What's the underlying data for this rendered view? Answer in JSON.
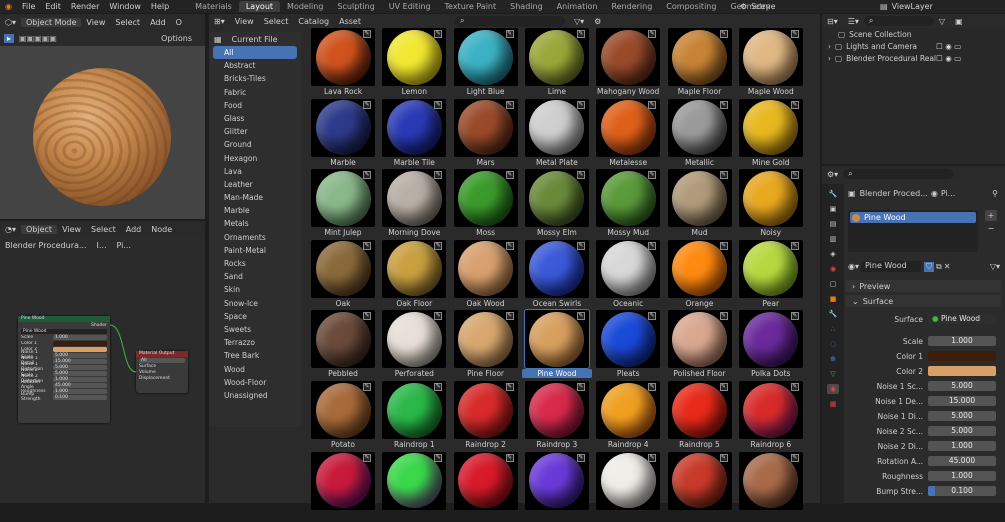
{
  "menu": [
    "File",
    "Edit",
    "Render",
    "Window",
    "Help"
  ],
  "workspaces": [
    "Materials",
    "Layout",
    "Modeling",
    "Sculpting",
    "UV Editing",
    "Texture Paint",
    "Shading",
    "Animation",
    "Rendering",
    "Compositing",
    "Geometry"
  ],
  "active_workspace": "Layout",
  "scene": "Scene",
  "view_layer": "ViewLayer",
  "viewport": {
    "mode": "Object Mode",
    "view": "View",
    "select": "Select",
    "add": "Add",
    "object": "O",
    "options": "Options"
  },
  "node_editor": {
    "mode": "Object",
    "view": "View",
    "select": "Select",
    "add": "Add",
    "node": "Node",
    "breadcrumb": "Blender Procedura...",
    "b2": "I...",
    "b3": "Pi..."
  },
  "node": {
    "group_title": "Pine Wood",
    "shader": "Shader",
    "name": "Pine Wood",
    "rows": [
      [
        "Scale",
        "1.000"
      ],
      [
        "Color 1",
        ""
      ],
      [
        "Color 2",
        ""
      ],
      [
        "Noise 1 Scale",
        "5.000"
      ],
      [
        "Noise 1 Detail",
        "15.000"
      ],
      [
        "Noise 1 Distortion",
        "5.000"
      ],
      [
        "Noise 2 Scale",
        "5.000"
      ],
      [
        "Noise 2 Distortion",
        "1.000"
      ],
      [
        "Rotation Angle",
        "45.000"
      ],
      [
        "Roughness",
        "1.000"
      ],
      [
        "Bump Strength",
        "0.100"
      ]
    ],
    "out_title": "Material Output",
    "out_all": "All",
    "out_rows": [
      "Surface",
      "Volume",
      "Displacement"
    ]
  },
  "asset_browser": {
    "library": "Current File",
    "menus": [
      "View",
      "Select",
      "Catalog",
      "Asset"
    ],
    "catalogs": [
      "All",
      "Abstract",
      "Bricks-Tiles",
      "Fabric",
      "Food",
      "Glass",
      "Glitter",
      "Ground",
      "Hexagon",
      "Lava",
      "Leather",
      "Man-Made",
      "Marble",
      "Metals",
      "Ornaments",
      "Paint-Metal",
      "Rocks",
      "Sand",
      "Skin",
      "Snow-Ice",
      "Space",
      "Sweets",
      "Terrazzo",
      "Tree Bark",
      "Wood",
      "Wood-Floor",
      "Unassigned"
    ],
    "active_catalog": "All",
    "assets": [
      [
        "Lava Rock",
        "#d0521c",
        "#2a0a04"
      ],
      [
        "Lemon",
        "#f2e832",
        "#b3a20a"
      ],
      [
        "Light Blue",
        "#3bb2c4",
        "#0f5a6a"
      ],
      [
        "Lime",
        "#9aa83a",
        "#4f5a1a"
      ],
      [
        "Mahogany Wood",
        "#9a4a2a",
        "#4a1e10"
      ],
      [
        "Maple Floor",
        "#c88436",
        "#6e4016"
      ],
      [
        "Maple Wood",
        "#e0b884",
        "#9a7042"
      ],
      [
        "Marble",
        "#2d3a8a",
        "#0c1030"
      ],
      [
        "Marble Tile",
        "#2a3ab6",
        "#0a1258"
      ],
      [
        "Mars",
        "#9a4a2a",
        "#3e1a0c"
      ],
      [
        "Metal Plate",
        "#cfcfcf",
        "#6a6a6a"
      ],
      [
        "Metalesse",
        "#e0601a",
        "#7a2a06"
      ],
      [
        "Metallic",
        "#9a9a9a",
        "#303030"
      ],
      [
        "Mine Gold",
        "#e8b820",
        "#8a6206"
      ],
      [
        "Mint Julep",
        "#8ab88a",
        "#3e6a44"
      ],
      [
        "Morning Dove",
        "#b8b0a6",
        "#5e5650"
      ],
      [
        "Moss",
        "#3a9a2a",
        "#0e4a0c"
      ],
      [
        "Mossy Elm",
        "#6a8a3a",
        "#2a3a14"
      ],
      [
        "Mossy Mud",
        "#5a9a3a",
        "#1a4a12"
      ],
      [
        "Mud",
        "#b09a7a",
        "#5a4a36"
      ],
      [
        "Noisy",
        "#e8a820",
        "#8a5a06"
      ],
      [
        "Oak",
        "#8a6a3a",
        "#3e2a12"
      ],
      [
        "Oak Floor",
        "#c8a040",
        "#6a5018"
      ],
      [
        "Oak Wood",
        "#d8a070",
        "#8a5a30"
      ],
      [
        "Ocean Swirls",
        "#3a5ad8",
        "#0a1a8a"
      ],
      [
        "Oceanic",
        "#d8d8d8",
        "#7a7a7a"
      ],
      [
        "Orange",
        "#ff8a10",
        "#b04a00"
      ],
      [
        "Pear",
        "#b8d840",
        "#5a8a10"
      ],
      [
        "Pebbled",
        "#6a4a3a",
        "#2a1a12"
      ],
      [
        "Perforated",
        "#e8e0d8",
        "#8a8278"
      ],
      [
        "Pine Floor",
        "#d8a870",
        "#8a6238"
      ],
      [
        "Pine Wood",
        "#d8a060",
        "#8a5420"
      ],
      [
        "Pleats",
        "#1a4ad8",
        "#061a6a"
      ],
      [
        "Polished Floor",
        "#d8a890",
        "#8a5a46"
      ],
      [
        "Polka Dots",
        "#6a2a9a",
        "#2a0a4a"
      ],
      [
        "Potato",
        "#a86a3a",
        "#5a3412"
      ],
      [
        "Raindrop 1",
        "#2ab84a",
        "#0a5a1a"
      ],
      [
        "Raindrop 2",
        "#d82a2a",
        "#6a0a0a"
      ],
      [
        "Raindrop 3",
        "#d82a4a",
        "#5a0a2a"
      ],
      [
        "Raindrop 4",
        "#f0a020",
        "#a03a06"
      ],
      [
        "Raindrop 5",
        "#e82a1a",
        "#8a0a06"
      ],
      [
        "Raindrop 6",
        "#d82a2a",
        "#4a0a6a"
      ],
      [
        "",
        "#c81a3a",
        "#3a0a6a"
      ],
      [
        "",
        "#3ad84a",
        "#6a1a8a"
      ],
      [
        "",
        "#d81a2a",
        "#6a0a0a"
      ],
      [
        "",
        "#6a3ad8",
        "#1a0a4a"
      ],
      [
        "",
        "#f0eee8",
        "#9a9890"
      ],
      [
        "",
        "#c83a2a",
        "#5a1a0a"
      ],
      [
        "",
        "#a86a4a",
        "#4a2a1a"
      ]
    ],
    "selected": "Pine Wood"
  },
  "outliner": {
    "collection": "Scene Collection",
    "items": [
      "Lights and Camera",
      "Blender Procedural Reali"
    ]
  },
  "properties": {
    "crumb": "Blender Proced...",
    "crumb2": "Pi...",
    "slot": "Pine Wood",
    "material": "Pine Wood",
    "preview": "Preview",
    "surface_section": "Surface",
    "surface_label": "Surface",
    "surface_value": "Pine Wood",
    "rows": [
      {
        "label": "Scale",
        "value": "1.000"
      },
      {
        "label": "Color 1",
        "value": "",
        "color": "#3a1e0a"
      },
      {
        "label": "Color 2",
        "value": "",
        "color": "#d8a066"
      },
      {
        "label": "Noise 1 Sc...",
        "value": "5.000"
      },
      {
        "label": "Noise 1 De...",
        "value": "15.000"
      },
      {
        "label": "Noise 1 Di...",
        "value": "5.000"
      },
      {
        "label": "Noise 2 Sc...",
        "value": "5.000"
      },
      {
        "label": "Noise 2 Di...",
        "value": "1.000"
      },
      {
        "label": "Rotation A...",
        "value": "45.000"
      },
      {
        "label": "Roughness",
        "value": "1.000"
      },
      {
        "label": "Bump Stre...",
        "value": "0.100",
        "fill": 0.1
      }
    ]
  }
}
